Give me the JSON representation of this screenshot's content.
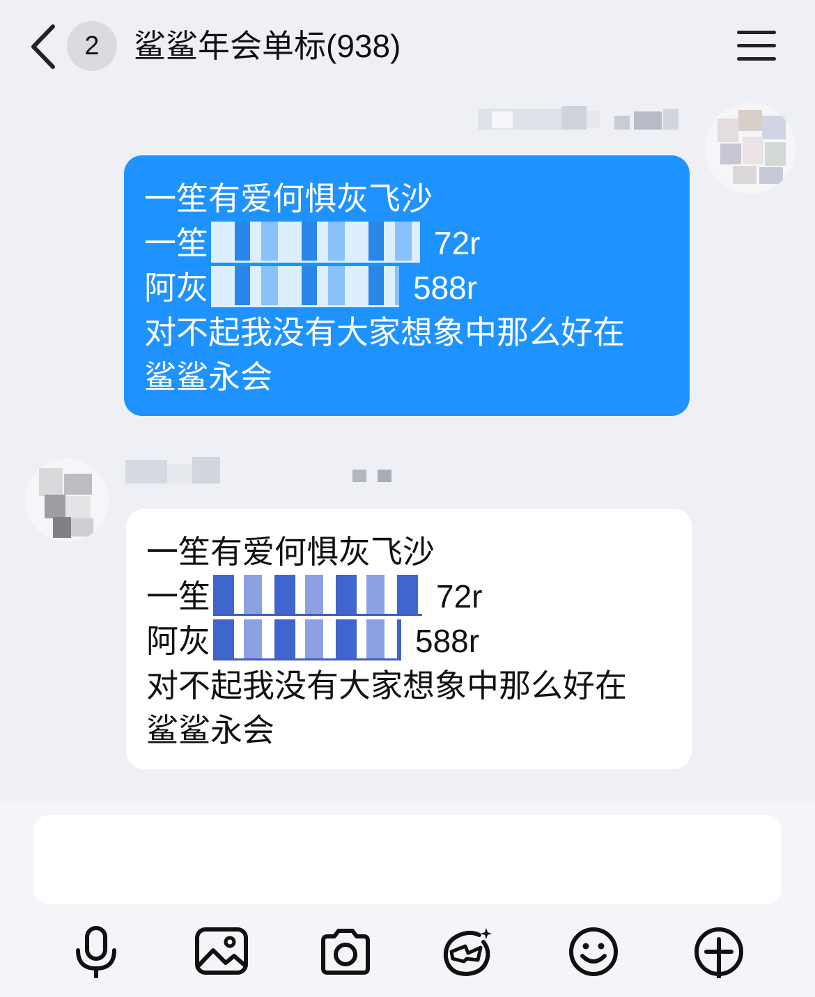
{
  "header": {
    "back_icon": "chevron-left-icon",
    "unread_badge": "2",
    "title": "鲨鲨年会单标(938)",
    "menu_icon": "hamburger-menu-icon"
  },
  "messages": [
    {
      "direction": "outgoing",
      "lines": [
        {
          "prefix": "一笙有爱何惧灰飞沙",
          "suffix": ""
        },
        {
          "prefix": "一笙",
          "suffix": "72r"
        },
        {
          "prefix": "阿灰",
          "suffix": "588r"
        },
        {
          "prefix": "对不起我没有大家想象中那么好在",
          "suffix": ""
        },
        {
          "prefix": "鲨鲨永会",
          "suffix": ""
        }
      ]
    },
    {
      "direction": "incoming",
      "lines": [
        {
          "prefix": "一笙有爱何惧灰飞沙",
          "suffix": ""
        },
        {
          "prefix": "一笙",
          "suffix": "72r"
        },
        {
          "prefix": "阿灰",
          "suffix": "588r"
        },
        {
          "prefix": "对不起我没有大家想象中那么好在",
          "suffix": ""
        },
        {
          "prefix": "鲨鲨永会",
          "suffix": ""
        }
      ]
    }
  ],
  "composer": {
    "value": "",
    "placeholder": ""
  },
  "toolbar": {
    "icons": [
      "microphone-icon",
      "image-icon",
      "camera-icon",
      "sticker-face-icon",
      "emoji-icon",
      "plus-icon"
    ]
  },
  "colors": {
    "outgoing_bubble": "#1e92ff",
    "incoming_bubble": "#ffffff",
    "background": "#eef0f5"
  }
}
